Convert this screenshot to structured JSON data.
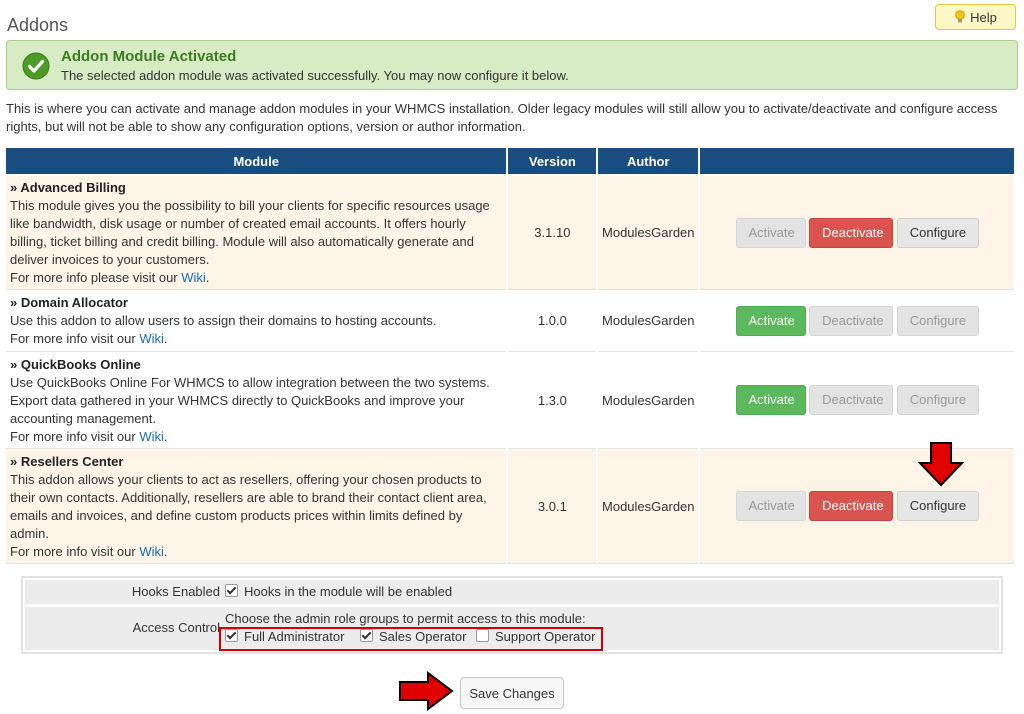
{
  "page": {
    "title": "Addons",
    "help_label": "Help"
  },
  "alert": {
    "title": "Addon Module Activated",
    "message": "The selected addon module was activated successfully. You may now configure it below."
  },
  "intro": "This is where you can activate and manage addon modules in your WHMCS installation. Older legacy modules will still allow you to activate/deactivate and configure access rights, but will not be able to show any configuration options, version or author information.",
  "table": {
    "headers": [
      "Module",
      "Version",
      "Author",
      ""
    ],
    "rows": [
      {
        "name": "» Advanced Billing",
        "description": "This module gives you the possibility to bill your clients for specific resources usage like bandwidth, disk usage or number of created email accounts. It offers hourly billing, ticket billing and credit billing. Module will also automatically generate and deliver invoices to your customers.",
        "more_info": "For more info please visit our ",
        "wiki": "Wiki",
        "version": "3.1.10",
        "author": "ModulesGarden",
        "activate": "Activate",
        "deactivate": "Deactivate",
        "configure": "Configure"
      },
      {
        "name": "» Domain Allocator",
        "description": "Use this addon to allow users to assign their domains to hosting accounts.",
        "more_info": "For more info visit our ",
        "wiki": "Wiki",
        "version": "1.0.0",
        "author": "ModulesGarden",
        "activate": "Activate",
        "deactivate": "Deactivate",
        "configure": "Configure"
      },
      {
        "name": "» QuickBooks Online",
        "description": "Use QuickBooks Online For WHMCS to allow integration between the two systems. Export data gathered in your WHMCS directly to QuickBooks and improve your accounting management.",
        "more_info": "For more info visit our ",
        "wiki": "Wiki",
        "version": "1.3.0",
        "author": "ModulesGarden",
        "activate": "Activate",
        "deactivate": "Deactivate",
        "configure": "Configure"
      },
      {
        "name": "» Resellers Center",
        "description": "This addon allows your clients to act as resellers, offering your chosen products to their own contacts. Additionally, resellers are able to brand their contact client area, emails and invoices, and define custom products prices within limits defined by admin.",
        "more_info": "For more info visit our ",
        "wiki": "Wiki",
        "version": "3.0.1",
        "author": "ModulesGarden",
        "activate": "Activate",
        "deactivate": "Deactivate",
        "configure": "Configure"
      }
    ]
  },
  "config": {
    "hooks_label": "Hooks Enabled",
    "hooks_text": "Hooks in the module will be enabled",
    "hooks_checked": true,
    "access_label": "Access Control",
    "access_text": "Choose the admin role groups to permit access to this module:",
    "roles": [
      {
        "label": "Full Administrator",
        "checked": true
      },
      {
        "label": "Sales Operator",
        "checked": true
      },
      {
        "label": "Support Operator",
        "checked": false
      }
    ]
  },
  "save_label": "Save Changes",
  "colors": {
    "header_bg": "#1a4d80",
    "alert_bg": "#d7ecc5",
    "danger": "#d9534f",
    "success": "#5cb85c",
    "annotation_red": "#e00000"
  }
}
